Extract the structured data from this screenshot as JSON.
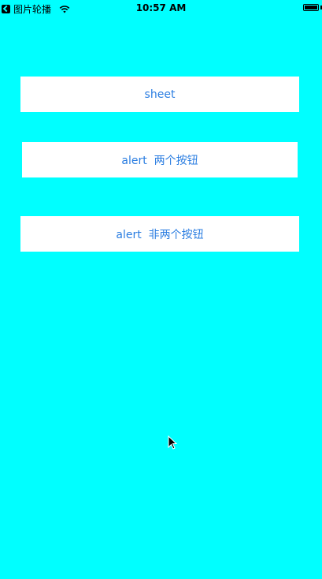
{
  "status_bar": {
    "carrier": "图片轮播",
    "time": "10:57 AM",
    "battery_level": 1.0
  },
  "icons": {
    "back": "back-app-icon",
    "wifi": "wifi-icon",
    "battery": "battery-icon",
    "cursor": "mouse-pointer-icon"
  },
  "colors": {
    "background": "#00FFFF",
    "button_bg": "#FFFFFF",
    "button_text": "#2A7DE1"
  },
  "buttons": [
    {
      "label": "sheet"
    },
    {
      "label": "alert  两个按钮"
    },
    {
      "label": "alert  非两个按钮"
    }
  ]
}
